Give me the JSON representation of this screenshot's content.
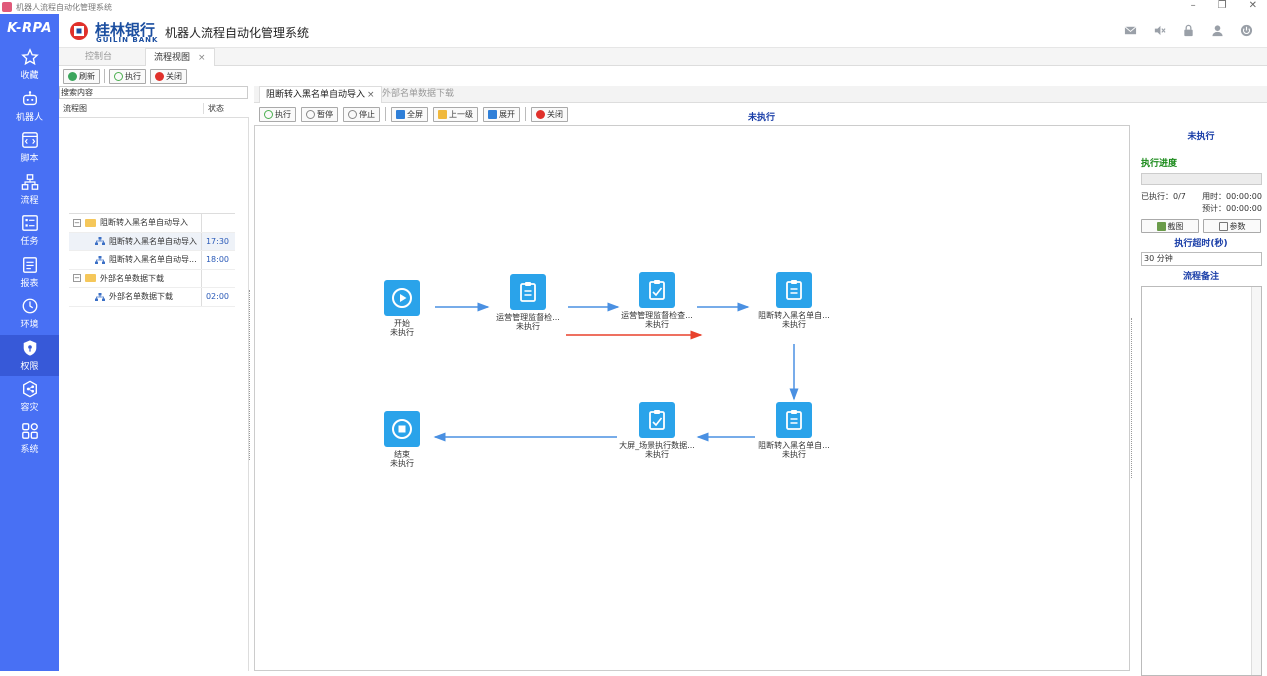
{
  "window": {
    "title": "机器人流程自动化管理系统",
    "controls": [
      "–",
      "❐",
      "✕"
    ]
  },
  "sidebar": {
    "brand": "K-RPA",
    "items": [
      {
        "label": "收藏",
        "icon": "star-icon"
      },
      {
        "label": "机器人",
        "icon": "robot-icon"
      },
      {
        "label": "脚本",
        "icon": "code-icon"
      },
      {
        "label": "流程",
        "icon": "flow-icon"
      },
      {
        "label": "任务",
        "icon": "task-icon"
      },
      {
        "label": "报表",
        "icon": "report-icon"
      },
      {
        "label": "环境",
        "icon": "environment-icon"
      },
      {
        "label": "权限",
        "icon": "permission-icon"
      },
      {
        "label": "容灾",
        "icon": "disaster-recovery-icon"
      },
      {
        "label": "系统",
        "icon": "system-icon"
      }
    ],
    "active_index": 7
  },
  "header": {
    "logo_cn": "桂林银行",
    "logo_en": "GUILIN BANK",
    "system_title": "机器人流程自动化管理系统",
    "icons": [
      "mail-icon",
      "mute-icon",
      "lock-icon",
      "user-icon",
      "power-icon"
    ]
  },
  "main_tabs": [
    {
      "label": "控制台",
      "active": false
    },
    {
      "label": "流程视图",
      "active": true,
      "close": "×"
    }
  ],
  "left_toolbar": {
    "refresh": "刷新",
    "execute": "执行",
    "close": "关闭"
  },
  "search": {
    "placeholder": "搜索内容"
  },
  "grid": {
    "col_flow": "流程图",
    "col_status": "状态"
  },
  "tree": [
    {
      "type": "group",
      "expander": "−",
      "label": "阻断转入黑名单自动导入",
      "time": ""
    },
    {
      "type": "item",
      "label": "阻断转入黑名单自动导入",
      "time": "17:30",
      "selected": true
    },
    {
      "type": "item",
      "label": "阻断转入黑名单自动导...",
      "time": "18:00",
      "selected": false
    },
    {
      "type": "group",
      "expander": "−",
      "label": "外部名单数据下载",
      "time": ""
    },
    {
      "type": "item",
      "label": "外部名单数据下载",
      "time": "02:00",
      "selected": false
    }
  ],
  "content_tabs": [
    {
      "label": "阻断转入黑名单自动导入",
      "active": true,
      "close": "×"
    },
    {
      "label": "外部名单数据下载",
      "active": false
    }
  ],
  "content_toolbar": {
    "execute": "执行",
    "pause": "暂停",
    "stop": "停止",
    "fullscreen": "全屏",
    "up_level": "上一级",
    "expand": "展开",
    "close": "关闭"
  },
  "status_text": "未执行",
  "flow": {
    "nodes": [
      {
        "id": "start",
        "name": "开始",
        "status": "未执行",
        "kind": "start"
      },
      {
        "id": "n1",
        "name": "运营管理监督检...",
        "status": "未执行",
        "kind": "task"
      },
      {
        "id": "n2",
        "name": "运营管理监督检查...",
        "status": "未执行",
        "kind": "task"
      },
      {
        "id": "n3",
        "name": "阻断转入黑名单自...",
        "status": "未执行",
        "kind": "task"
      },
      {
        "id": "n4",
        "name": "阻断转入黑名单自...",
        "status": "未执行",
        "kind": "task"
      },
      {
        "id": "n5",
        "name": "大屏_场景执行数据...",
        "status": "未执行",
        "kind": "task"
      },
      {
        "id": "end",
        "name": "结束",
        "status": "未执行",
        "kind": "end"
      }
    ],
    "colors": {
      "node": "#2aa3ea",
      "arrow": "#4a90e2",
      "highlight": "#e8412c"
    }
  },
  "right_panel": {
    "status": "未执行",
    "progress_label": "执行进度",
    "progress": 0,
    "executed": "已执行：0/7",
    "elapsed": "用时：00:00:00",
    "estimated": "预计：00:00:00",
    "screenshot_btn": "截图",
    "params_btn": "参数",
    "timeout_label": "执行超时(秒)",
    "timeout_value": "30 分钟",
    "notes_label": "流程备注"
  }
}
